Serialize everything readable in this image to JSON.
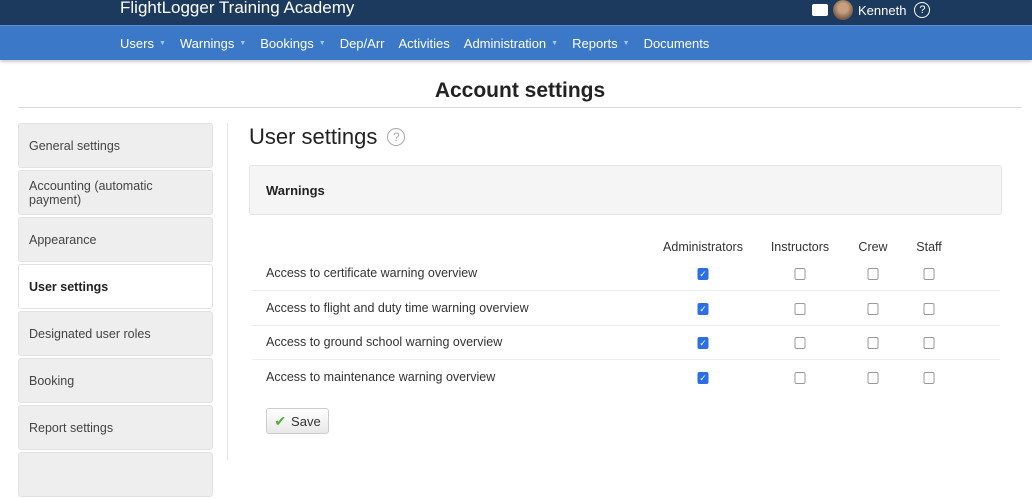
{
  "header": {
    "brand": "FlightLogger Training Academy",
    "user": "Kenneth",
    "help": "?"
  },
  "nav": [
    {
      "label": "Users",
      "dropdown": true
    },
    {
      "label": "Warnings",
      "dropdown": true
    },
    {
      "label": "Bookings",
      "dropdown": true
    },
    {
      "label": "Dep/Arr",
      "dropdown": false
    },
    {
      "label": "Activities",
      "dropdown": false
    },
    {
      "label": "Administration",
      "dropdown": true
    },
    {
      "label": "Reports",
      "dropdown": true
    },
    {
      "label": "Documents",
      "dropdown": false
    }
  ],
  "page_title": "Account settings",
  "sidebar": [
    "General settings",
    "Accounting (automatic payment)",
    "Appearance",
    "User settings",
    "Designated user roles",
    "Booking",
    "Report settings"
  ],
  "section_title": "User settings",
  "panel_title": "Warnings",
  "columns": [
    "Administrators",
    "Instructors",
    "Crew",
    "Staff"
  ],
  "rows": [
    {
      "label": "Access to certificate warning overview",
      "checks": [
        true,
        false,
        false,
        false
      ]
    },
    {
      "label": "Access to flight and duty time warning overview",
      "checks": [
        true,
        false,
        false,
        false
      ]
    },
    {
      "label": "Access to ground school warning overview",
      "checks": [
        true,
        false,
        false,
        false
      ]
    },
    {
      "label": "Access to maintenance warning overview",
      "checks": [
        true,
        false,
        false,
        false
      ]
    }
  ],
  "save_label": "Save"
}
